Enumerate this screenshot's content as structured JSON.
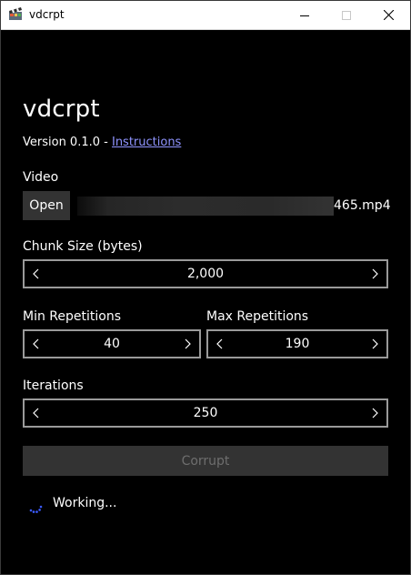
{
  "window": {
    "title": "vdcrpt",
    "min_icon": "minimize-icon",
    "max_icon": "maximize-icon",
    "close_icon": "close-icon",
    "app_icon": "clapperboard-icon"
  },
  "header": {
    "app_name": "vdcrpt",
    "version_text": "Version 0.1.0 - ",
    "instructions_link": "Instructions"
  },
  "video": {
    "label": "Video",
    "open_button": "Open",
    "file_suffix": "465.mp4"
  },
  "chunk_size": {
    "label": "Chunk Size (bytes)",
    "value": "2,000"
  },
  "min_repetitions": {
    "label": "Min Repetitions",
    "value": "40"
  },
  "max_repetitions": {
    "label": "Max Repetitions",
    "value": "190"
  },
  "iterations": {
    "label": "Iterations",
    "value": "250"
  },
  "corrupt_button": "Corrupt",
  "status": {
    "text": "Working...",
    "icon": "spinner-icon"
  },
  "colors": {
    "background": "#000000",
    "link": "#8f94ff",
    "spinner": "#3b5bff",
    "button_bg": "#333333",
    "stepper_border": "#9a9a9a"
  }
}
